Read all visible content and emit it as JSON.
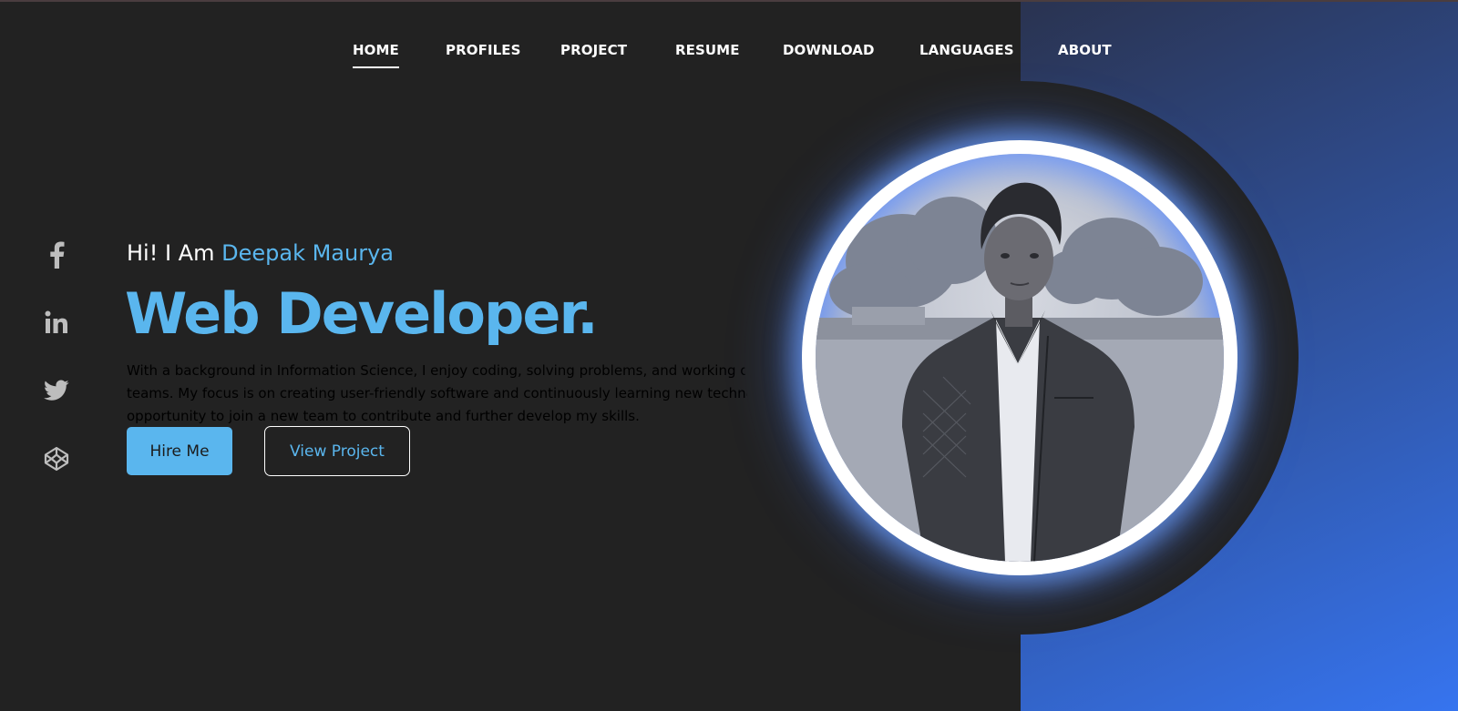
{
  "nav": {
    "items": [
      {
        "label": "HOME",
        "active": true
      },
      {
        "label": "PROFILES",
        "active": false
      },
      {
        "label": "PROJECT",
        "active": false
      },
      {
        "label": "RESUME",
        "active": false
      },
      {
        "label": "DOWNLOAD",
        "active": false
      },
      {
        "label": "LANGUAGES",
        "active": false
      },
      {
        "label": "ABOUT",
        "active": false
      }
    ]
  },
  "social": [
    {
      "icon": "facebook-icon"
    },
    {
      "icon": "linkedin-icon"
    },
    {
      "icon": "twitter-icon"
    },
    {
      "icon": "codepen-icon"
    }
  ],
  "hero": {
    "greeting_prefix": "Hi! I Am ",
    "name": "Deepak Maurya",
    "title": "Web Developer.",
    "description_lines": [
      "With a background in Information Science, I enjoy coding, solving problems, and working on",
      "teams. My focus is on creating user-friendly software and continuously learning new technologies. I am seeking an",
      "opportunity to join a new team to contribute and further develop my skills."
    ],
    "hire_label": "Hire Me",
    "view_label": "View Project"
  },
  "colors": {
    "background": "#222222",
    "accent": "#5ab6ee",
    "panel_gradient_end": "#3674ef"
  }
}
